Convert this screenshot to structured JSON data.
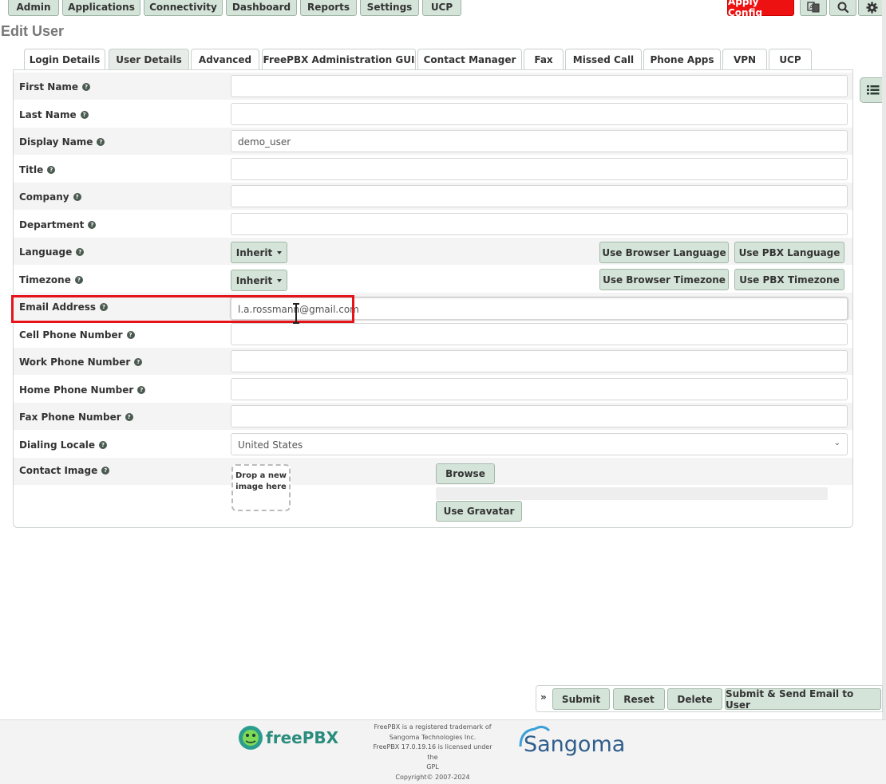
{
  "nav": {
    "items": [
      "Admin",
      "Applications",
      "Connectivity",
      "Dashboard",
      "Reports",
      "Settings",
      "UCP"
    ],
    "apply_config": "Apply Config",
    "icons": [
      "language-icon",
      "search-icon",
      "gear-icon"
    ]
  },
  "page_title": "Edit User",
  "tabs": [
    "Login Details",
    "User Details",
    "Advanced",
    "FreePBX Administration GUI",
    "Contact Manager",
    "Fax",
    "Missed Call",
    "Phone Apps",
    "VPN",
    "UCP"
  ],
  "active_tab": "User Details",
  "fields": {
    "first_name": {
      "label": "First Name",
      "value": ""
    },
    "last_name": {
      "label": "Last Name",
      "value": ""
    },
    "display_name": {
      "label": "Display Name",
      "value": "demo_user"
    },
    "title": {
      "label": "Title",
      "value": ""
    },
    "company": {
      "label": "Company",
      "value": ""
    },
    "department": {
      "label": "Department",
      "value": ""
    },
    "language": {
      "label": "Language",
      "value": "Inherit",
      "btn_browser": "Use Browser Language",
      "btn_pbx": "Use PBX Language"
    },
    "timezone": {
      "label": "Timezone",
      "value": "Inherit",
      "btn_browser": "Use Browser Timezone",
      "btn_pbx": "Use PBX Timezone"
    },
    "email": {
      "label": "Email Address",
      "value": "l.a.rossmann@gmail.com"
    },
    "cell_phone": {
      "label": "Cell Phone Number",
      "value": ""
    },
    "work_phone": {
      "label": "Work Phone Number",
      "value": ""
    },
    "home_phone": {
      "label": "Home Phone Number",
      "value": ""
    },
    "fax_phone": {
      "label": "Fax Phone Number",
      "value": ""
    },
    "dialing_locale": {
      "label": "Dialing Locale",
      "value": "United States"
    },
    "contact_image": {
      "label": "Contact Image",
      "dropzone_line1": "Drop a new",
      "dropzone_line2": "image here",
      "browse": "Browse",
      "gravatar": "Use Gravatar"
    }
  },
  "actions": {
    "expand": "»",
    "submit": "Submit",
    "reset": "Reset",
    "delete": "Delete",
    "submit_email": "Submit & Send Email to User"
  },
  "footer": {
    "freepbx_brand": "freePBX",
    "sangoma_brand": "Sangoma",
    "lines": [
      "FreePBX is a registered trademark of",
      "Sangoma Technologies Inc.",
      "FreePBX 17.0.19.16 is licensed under the",
      "GPL",
      "Copyright© 2007-2024"
    ]
  },
  "colors": {
    "accent_green": "#d4e4d9",
    "apply_red": "#ee1111",
    "highlight_red": "#e5141a"
  }
}
